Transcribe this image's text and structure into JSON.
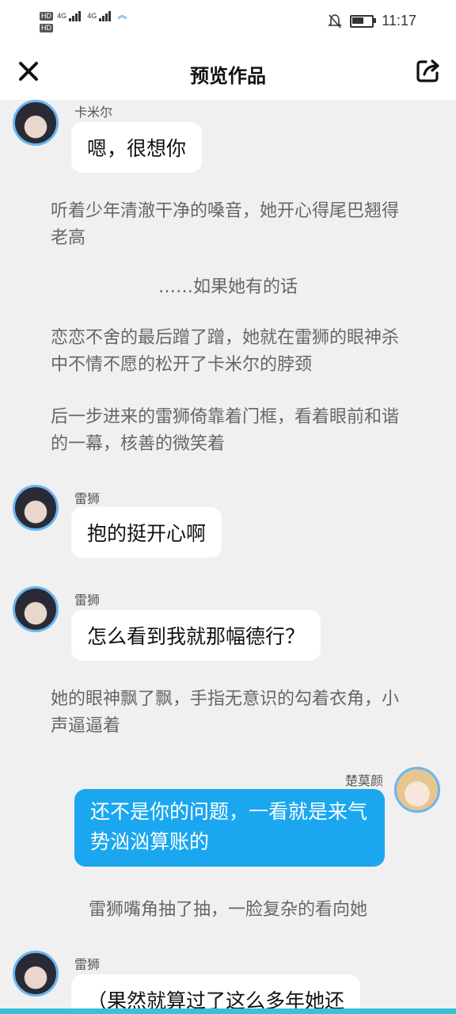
{
  "status_bar": {
    "hd1": "HD",
    "hd2": "HD",
    "net1": "4G",
    "net2": "4G",
    "time": "11:17",
    "battery_level": 0.6
  },
  "header": {
    "title": "预览作品",
    "close_icon": "close-icon",
    "share_icon": "share-icon"
  },
  "messages": [
    {
      "name": "卡米尔",
      "text": "嗯，很想你"
    },
    {
      "name": "雷狮",
      "text": "抱的挺开心啊"
    },
    {
      "name": "雷狮",
      "text": "怎么看到我就那幅德行？"
    },
    {
      "name": "楚莫颜",
      "text": "还不是你的问题，一看就是来气势汹汹算账的"
    },
    {
      "name": "雷狮",
      "text": "（果然就算过了这么多年她还"
    }
  ],
  "narrations": [
    "听着少年清澈干净的嗓音，她开心得尾巴翘得老高",
    "……如果她有的话",
    "恋恋不舍的最后蹭了蹭，她就在雷狮的眼神杀中不情不愿的松开了卡米尔的脖颈",
    "后一步进来的雷狮倚靠着门框，看着眼前和谐的一幕，核善的微笑着",
    "她的眼神飘了飘，手指无意识的勾着衣角，小声逼逼着",
    "雷狮嘴角抽了抽，一脸复杂的看向她"
  ],
  "colors": {
    "accent": "#1aa7f0",
    "avatar_ring": "#6ab6f2",
    "bottom_bar": "#37c3d6"
  }
}
